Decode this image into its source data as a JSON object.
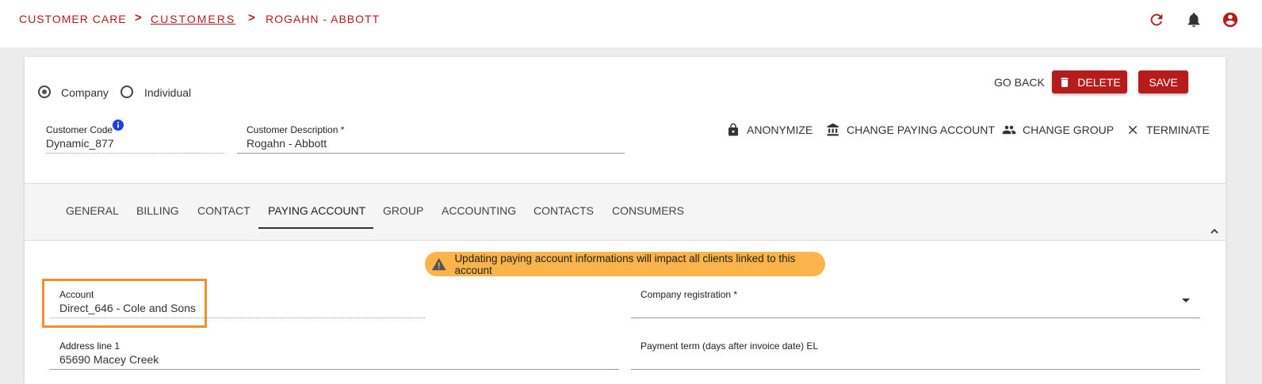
{
  "breadcrumb": {
    "items": [
      "CUSTOMER CARE",
      "CUSTOMERS",
      "ROGAHN - ABBOTT"
    ],
    "separator": ">"
  },
  "header_icons": [
    "refresh-icon",
    "bell-icon",
    "account-icon"
  ],
  "colors": {
    "brand": "#b71c1c",
    "warning": "#fbb44b",
    "highlight": "#f0902f"
  },
  "customer_type": {
    "options": [
      "Company",
      "Individual"
    ],
    "selected": "Company"
  },
  "customer_code": {
    "label": "Customer Code",
    "value": "Dynamic_877"
  },
  "customer_description": {
    "label": "Customer Description *",
    "value": "Rogahn - Abbott"
  },
  "actions": {
    "go_back": "GO BACK",
    "delete": "DELETE",
    "save": "SAVE",
    "anonymize": "ANONYMIZE",
    "change_paying_account": "CHANGE PAYING ACCOUNT",
    "change_group": "CHANGE GROUP",
    "terminate": "TERMINATE"
  },
  "tabs": [
    "GENERAL",
    "BILLING",
    "CONTACT",
    "PAYING ACCOUNT",
    "GROUP",
    "ACCOUNTING",
    "CONTACTS",
    "CONSUMERS"
  ],
  "active_tab": "PAYING ACCOUNT",
  "warning": "Updating paying account informations will impact all clients linked to this account",
  "form": {
    "account": {
      "label": "Account",
      "value": "Direct_646 - Cole and Sons"
    },
    "company_registration": {
      "label": "Company registration *",
      "value": ""
    },
    "address_line_1": {
      "label": "Address line 1",
      "value": "65690 Macey Creek"
    },
    "payment_term": {
      "label": "Payment term (days after invoice date) EL",
      "value": ""
    }
  }
}
